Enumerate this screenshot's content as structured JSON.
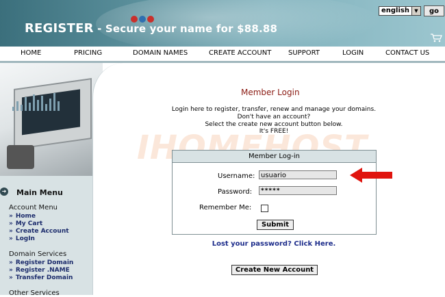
{
  "header": {
    "title_brand": "REGISTER",
    "title_rest": " - Secure your name for $88.88",
    "language_selected": "english",
    "go_label": "go",
    "ball_colors": [
      "#c9302c",
      "#2f6fb0",
      "#c9302c"
    ]
  },
  "nav": {
    "items": [
      "HOME",
      "PRICING",
      "DOMAIN NAMES",
      "CREATE ACCOUNT",
      "SUPPORT",
      "LOGIN",
      "CONTACT US"
    ]
  },
  "sidebar": {
    "main_menu_title": "Main Menu",
    "sections": [
      {
        "title": "Account Menu",
        "links": [
          "Home",
          "My Cart",
          "Create Account",
          "LogIn"
        ]
      },
      {
        "title": "Domain Services",
        "links": [
          "Register Domain",
          "Register .NAME",
          "Transfer Domain"
        ]
      },
      {
        "title": "Other Services",
        "links": []
      }
    ]
  },
  "main": {
    "title": "Member Login",
    "intro_lines": [
      "Login here to register, transfer, renew and manage your domains.",
      "Don't have an account?",
      "Select the create new account button below.",
      "It's FREE!"
    ],
    "watermark": "IHOMEHOST",
    "login_box": {
      "header": "Member Log-in",
      "username_label": "Username:",
      "username_value": "usuario",
      "password_label": "Password:",
      "password_value": "*****",
      "remember_label": "Remember Me:",
      "submit_label": "Submit"
    },
    "forgot_link": "Lost your password? Click Here.",
    "create_account_label": "Create New Account"
  },
  "colors": {
    "accent_red": "#e0140e",
    "title_red": "#8a1a12",
    "link_blue": "#1b2b8a"
  }
}
